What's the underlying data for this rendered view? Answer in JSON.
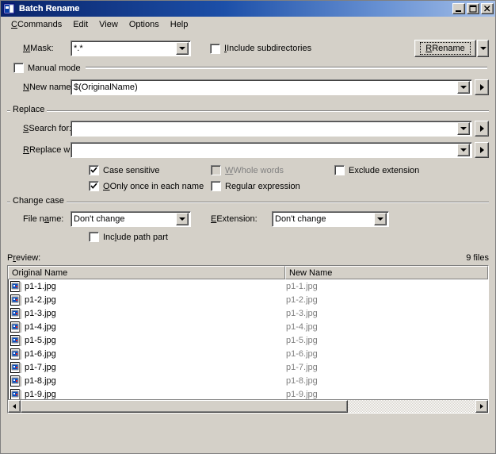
{
  "window": {
    "title": "Batch Rename",
    "icon": "app-icon",
    "buttons": {
      "minimize": "minimize-icon",
      "maximize": "maximize-icon",
      "close": "close-icon"
    }
  },
  "menu": {
    "items": [
      {
        "label": "Commands",
        "accel": "C"
      },
      {
        "label": "Edit",
        "accel": "E"
      },
      {
        "label": "View",
        "accel": "V"
      },
      {
        "label": "Options",
        "accel": "O"
      },
      {
        "label": "Help",
        "accel": "H"
      }
    ]
  },
  "mask": {
    "label": "Mask:",
    "value": "*.*",
    "placeholder": ""
  },
  "include_subdirectories": {
    "label": "Include subdirectories",
    "checked": false
  },
  "rename_button": {
    "label": "Rename",
    "dropdown": "chevron-down-icon"
  },
  "manual_mode": {
    "label": "Manual mode",
    "checked": false
  },
  "new_name": {
    "label": "New name:",
    "value": "$(OriginalName)",
    "placeholder": ""
  },
  "replace": {
    "group_title": "Replace",
    "search_for": {
      "label": "Search for:",
      "value": "",
      "placeholder": ""
    },
    "replace_with": {
      "label": "Replace with:",
      "value": "",
      "placeholder": ""
    },
    "options": [
      {
        "label": "Case sensitive",
        "checked": true,
        "disabled": false
      },
      {
        "label": "Whole words",
        "checked": false,
        "disabled": true
      },
      {
        "label": "Exclude extension",
        "checked": false,
        "disabled": false
      },
      {
        "label": "Only once in each name",
        "checked": true,
        "disabled": false
      },
      {
        "label": "Regular expression",
        "checked": false,
        "disabled": false
      }
    ]
  },
  "change_case": {
    "group_title": "Change case",
    "file_name": {
      "label": "File name:",
      "value": "Don't change"
    },
    "extension": {
      "label": "Extension:",
      "value": "Don't change"
    },
    "include_path_part": {
      "label": "Include path part",
      "checked": false
    }
  },
  "preview": {
    "label": "Preview:",
    "file_count": "9 files",
    "columns": [
      "Original Name",
      "New Name"
    ],
    "rows": [
      {
        "original": "p1-1.jpg",
        "new": "p1-1.jpg",
        "icon": "image-file-icon"
      },
      {
        "original": "p1-2.jpg",
        "new": "p1-2.jpg",
        "icon": "image-file-icon"
      },
      {
        "original": "p1-3.jpg",
        "new": "p1-3.jpg",
        "icon": "image-file-icon"
      },
      {
        "original": "p1-4.jpg",
        "new": "p1-4.jpg",
        "icon": "image-file-icon"
      },
      {
        "original": "p1-5.jpg",
        "new": "p1-5.jpg",
        "icon": "image-file-icon"
      },
      {
        "original": "p1-6.jpg",
        "new": "p1-6.jpg",
        "icon": "image-file-icon"
      },
      {
        "original": "p1-7.jpg",
        "new": "p1-7.jpg",
        "icon": "image-file-icon"
      },
      {
        "original": "p1-8.jpg",
        "new": "p1-8.jpg",
        "icon": "image-file-icon"
      },
      {
        "original": "p1-9.jpg",
        "new": "p1-9.jpg",
        "icon": "image-file-icon"
      }
    ]
  },
  "scrollbar": {
    "left_arrow": "arrow-left-icon",
    "right_arrow": "arrow-right-icon",
    "thumb_percent": 72
  },
  "colors": {
    "face": "#d4d0c8",
    "title_start": "#0a246a",
    "title_end": "#a6c0e8",
    "disabled_text": "#808080",
    "preview_new_text": "#808080"
  }
}
